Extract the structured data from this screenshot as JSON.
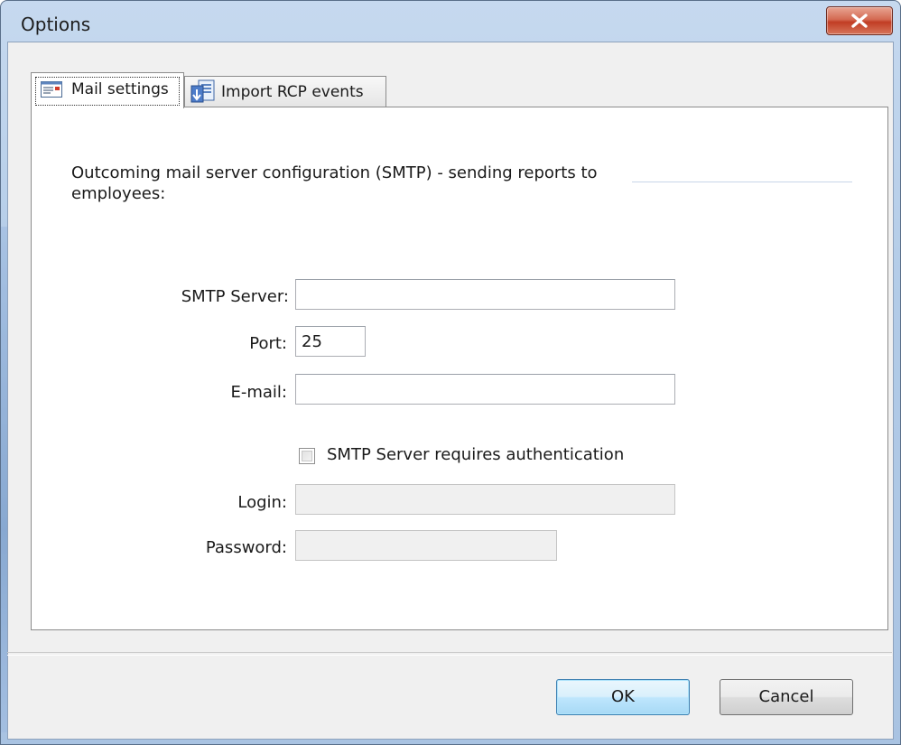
{
  "window": {
    "title": "Options"
  },
  "tabs": [
    {
      "label": "Mail settings",
      "icon": "mail-settings-icon",
      "active": true
    },
    {
      "label": "Import RCP events",
      "icon": "import-events-icon",
      "active": false
    }
  ],
  "mail_settings": {
    "description": "Outcoming mail server configuration (SMTP) - sending reports to employees:",
    "smtp_server": {
      "label": "SMTP Server:",
      "value": ""
    },
    "port": {
      "label": "Port:",
      "value": "25"
    },
    "email": {
      "label": "E-mail:",
      "value": ""
    },
    "auth_checkbox": {
      "label": "SMTP Server requires authentication",
      "checked": false
    },
    "login": {
      "label": "Login:",
      "value": "",
      "enabled": false
    },
    "password": {
      "label": "Password:",
      "value": "",
      "enabled": false
    }
  },
  "buttons": {
    "ok": "OK",
    "cancel": "Cancel"
  },
  "colors": {
    "titlebar": "#b2cbe7",
    "close_button": "#c13d24",
    "default_button_border": "#3c7fb1"
  }
}
